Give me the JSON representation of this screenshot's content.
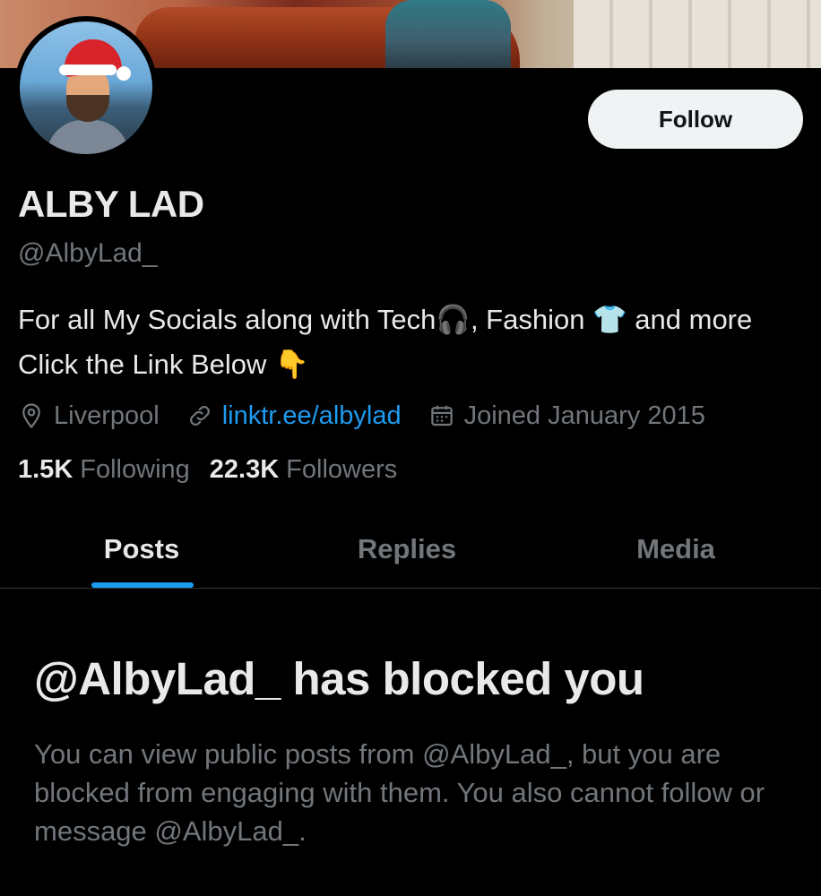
{
  "profile": {
    "display_name": "ALBY LAD",
    "handle": "@AlbyLad_",
    "bio_text": "For all My Socials along with Tech🎧, Fashion 👕 and more Click the Link Below 👇",
    "location": "Liverpool",
    "website": "linktr.ee/albylad",
    "joined": "Joined January 2015"
  },
  "actions": {
    "follow_label": "Follow"
  },
  "stats": {
    "following_count": "1.5K",
    "following_label": "Following",
    "followers_count": "22.3K",
    "followers_label": "Followers"
  },
  "tabs": [
    {
      "label": "Posts",
      "active": true
    },
    {
      "label": "Replies",
      "active": false
    },
    {
      "label": "Media",
      "active": false
    }
  ],
  "blocked": {
    "title": "@AlbyLad_ has blocked you",
    "message": "You can view public posts from @AlbyLad_, but you are blocked from engaging with them. You also cannot follow or message @AlbyLad_."
  },
  "icons": {
    "location": "location-pin-icon",
    "link": "link-icon",
    "calendar": "calendar-icon"
  },
  "colors": {
    "background": "#000000",
    "accent": "#1d9bf0",
    "text_primary": "#e7e9ea",
    "text_secondary": "#71767b",
    "follow_button_bg": "#eff3f4"
  }
}
